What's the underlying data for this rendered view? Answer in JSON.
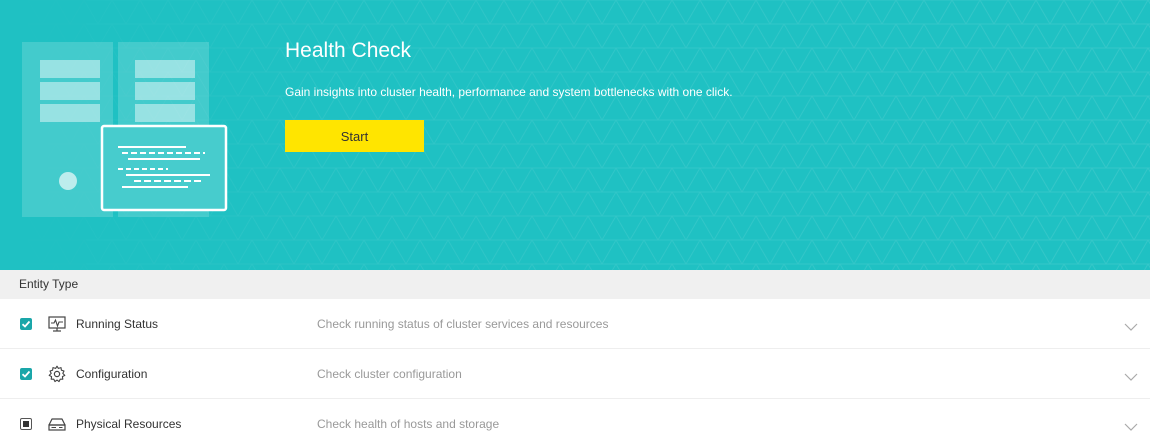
{
  "hero": {
    "title": "Health Check",
    "description": "Gain insights into cluster health, performance and system bottlenecks with one click.",
    "start_label": "Start",
    "bg_color": "#1fc1c3",
    "button_color": "#ffe500"
  },
  "entity_section": {
    "header": "Entity Type",
    "rows": [
      {
        "name": "Running Status",
        "description": "Check running status of cluster services and resources",
        "icon": "monitor-pulse-icon",
        "checkbox_state": "checked"
      },
      {
        "name": "Configuration",
        "description": "Check cluster configuration",
        "icon": "gear-icon",
        "checkbox_state": "checked"
      },
      {
        "name": "Physical Resources",
        "description": "Check health of hosts and storage",
        "icon": "hard-drive-icon",
        "checkbox_state": "partial"
      }
    ]
  },
  "colors": {
    "checkbox": "#1aa6a9",
    "muted_text": "#999999"
  }
}
